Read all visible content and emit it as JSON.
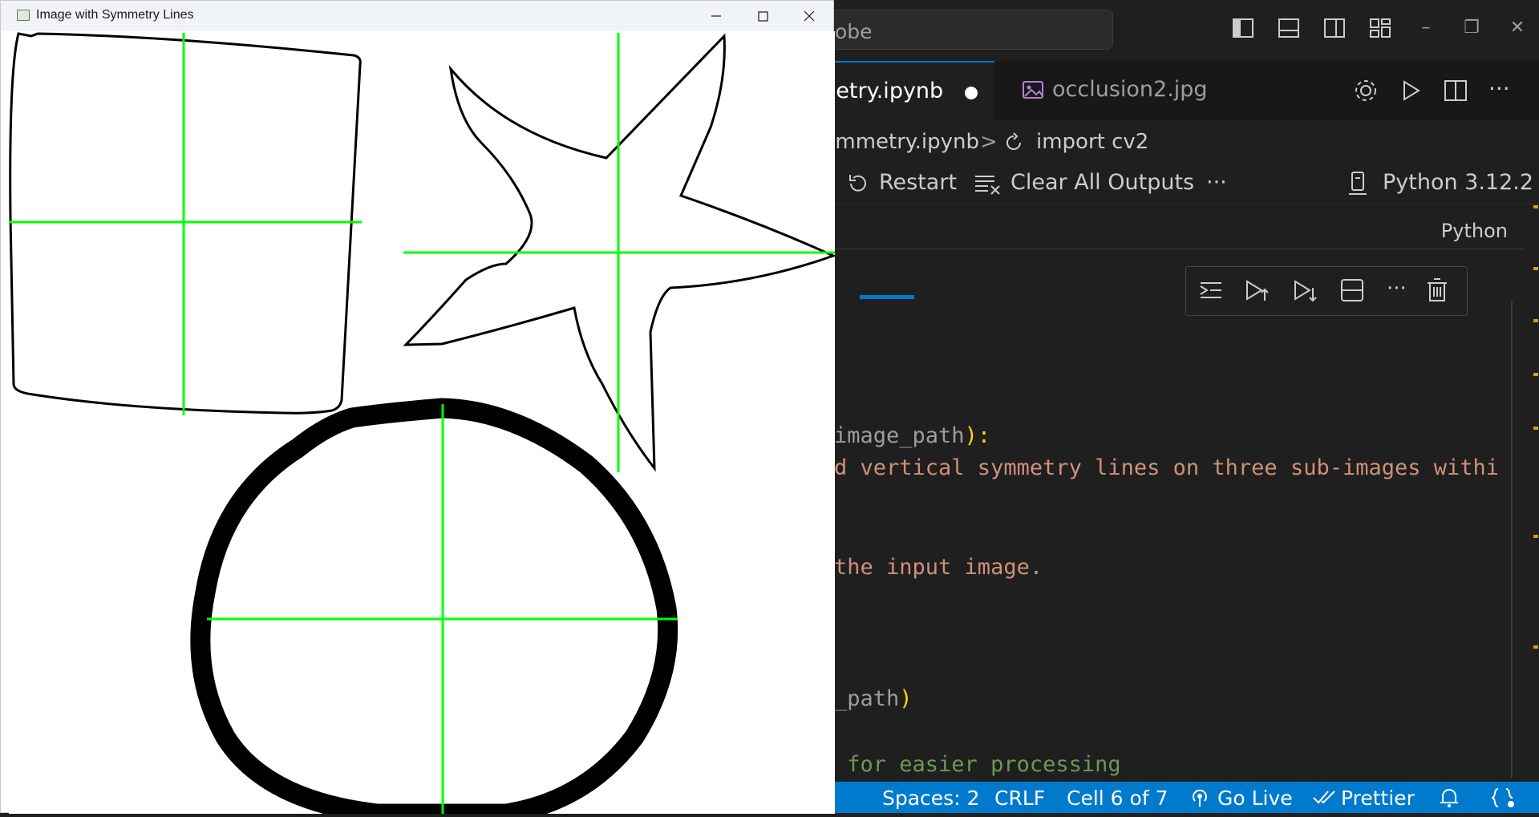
{
  "vscode": {
    "search_text": "obe",
    "tabs": [
      {
        "label": "metry.ipynb",
        "modified": true
      },
      {
        "label": "occlusion2.jpg"
      }
    ],
    "breadcrumb": {
      "file": "ymmetry.ipynb",
      "separator": ">",
      "symbol": "import cv2"
    },
    "toolbar": {
      "restart": "Restart",
      "clear_outputs": "Clear All Outputs",
      "more": "···",
      "kernel": "Python 3.12.2"
    },
    "cell_language": "Python",
    "code_lines": [
      {
        "text": "image_path",
        "suffix": "):"
      },
      {
        "text": "d vertical symmetry lines on three sub-images withi"
      },
      {
        "text": "the input image."
      },
      {
        "text": "_path",
        "suffix": ")"
      },
      {
        "text": " for easier processing"
      }
    ],
    "status": {
      "spaces": "Spaces: 2",
      "eol": "CRLF",
      "cell": "Cell 6 of 7",
      "go_live": "Go Live",
      "prettier": "Prettier"
    },
    "colors": {
      "background": "#1f1f1f",
      "status_bar": "#007acc",
      "string_orange": "#ce9178",
      "comment_green": "#6a9955",
      "param_gray": "#9cdcfe",
      "bracket_yellow": "#ffd700",
      "accent_blue": "#0078d4"
    }
  },
  "cv_window": {
    "title": "Image with Symmetry Lines",
    "colors": {
      "symmetry_line": "#00ff00",
      "shape_stroke": "#000000"
    }
  }
}
